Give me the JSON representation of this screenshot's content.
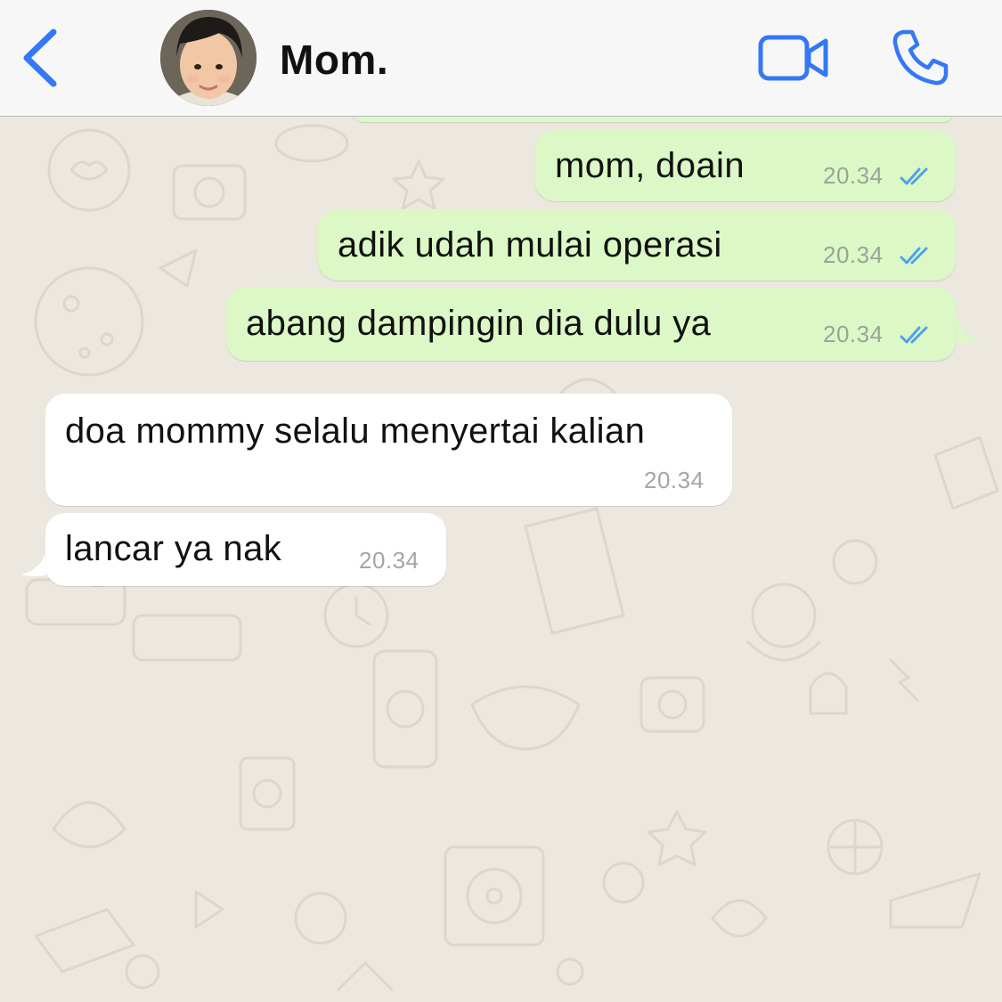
{
  "header": {
    "contact_name": "Mom.",
    "back_icon": "chevron-left-icon",
    "video_icon": "video-camera-icon",
    "call_icon": "phone-icon",
    "accent_color": "#3478f6"
  },
  "messages": [
    {
      "direction": "outgoing",
      "text": "mom, doain",
      "time": "20.34",
      "status": "read"
    },
    {
      "direction": "outgoing",
      "text": "adik udah mulai operasi",
      "time": "20.34",
      "status": "read"
    },
    {
      "direction": "outgoing",
      "text": "abang dampingin dia dulu ya",
      "time": "20.34",
      "status": "read"
    },
    {
      "direction": "incoming",
      "text": "doa mommy selalu menyertai kalian",
      "time": "20.34"
    },
    {
      "direction": "incoming",
      "text": "lancar ya nak",
      "time": "20.34"
    }
  ],
  "colors": {
    "outgoing_bubble": "#dcf8c6",
    "incoming_bubble": "#ffffff",
    "read_ticks": "#4fa3e8",
    "wallpaper": "#ece8e0"
  }
}
